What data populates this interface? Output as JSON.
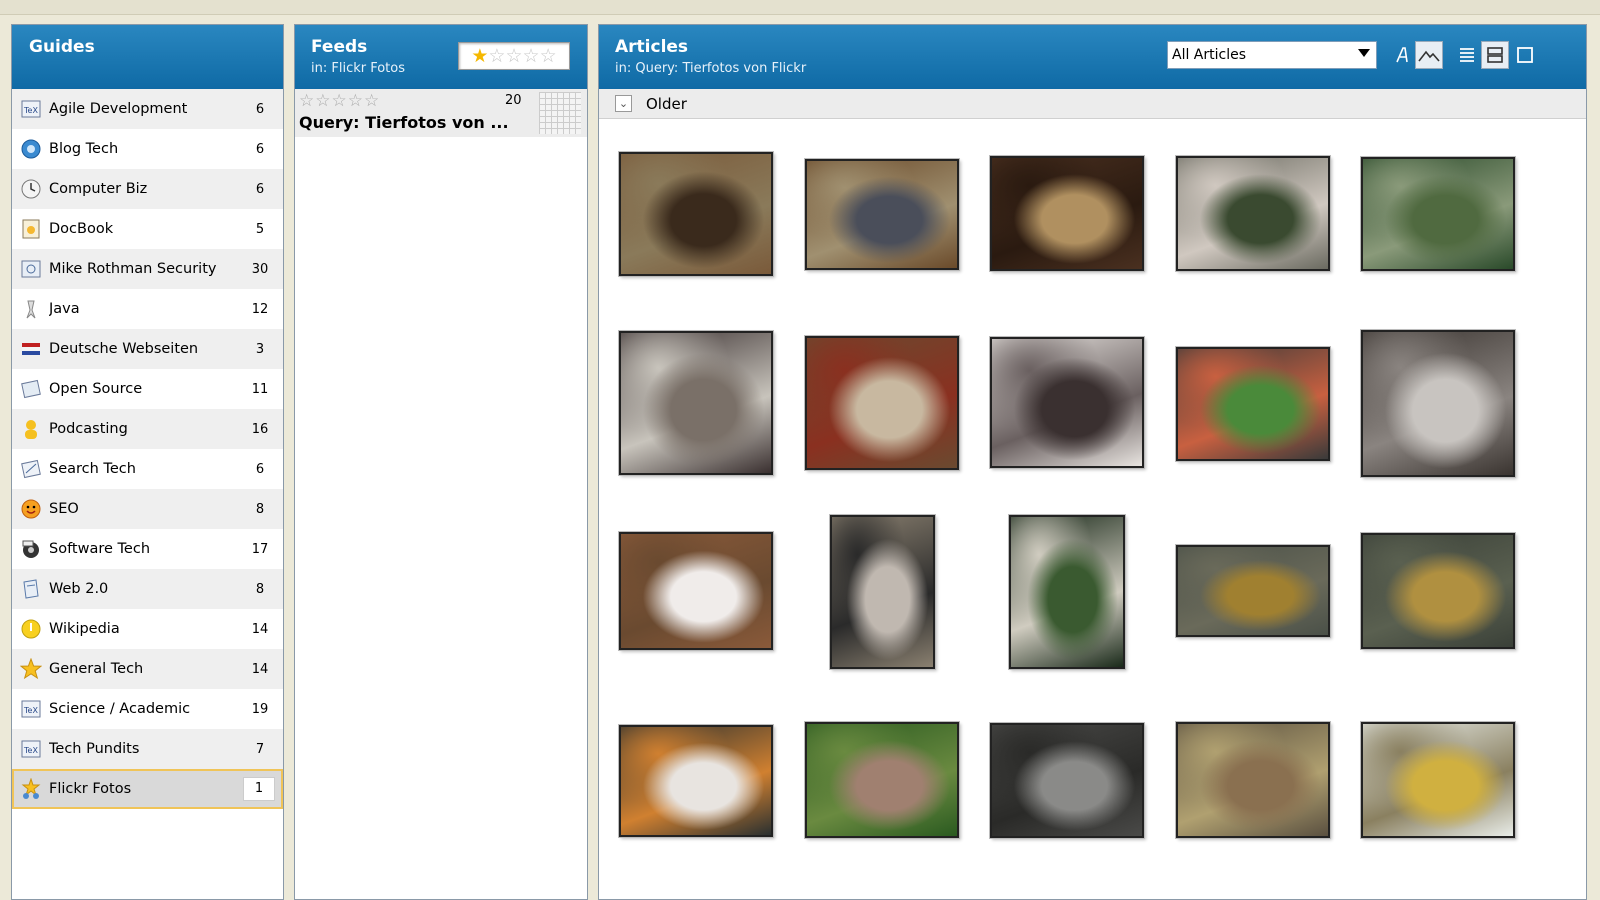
{
  "guides": {
    "title": "Guides",
    "items": [
      {
        "label": "Agile Development",
        "count": "6",
        "icon": "tex-document-icon"
      },
      {
        "label": "Blog Tech",
        "count": "6",
        "icon": "gear-globe-icon"
      },
      {
        "label": "Computer Biz",
        "count": "6",
        "icon": "clock-icon"
      },
      {
        "label": "DocBook",
        "count": "5",
        "icon": "docbook-icon"
      },
      {
        "label": "Mike Rothman Security",
        "count": "30",
        "icon": "security-document-icon"
      },
      {
        "label": "Java",
        "count": "12",
        "icon": "java-duke-icon"
      },
      {
        "label": "Deutsche Webseiten",
        "count": "3",
        "icon": "flag-icon"
      },
      {
        "label": "Open Source",
        "count": "11",
        "icon": "open-source-icon"
      },
      {
        "label": "Podcasting",
        "count": "16",
        "icon": "person-icon"
      },
      {
        "label": "Search Tech",
        "count": "6",
        "icon": "search-document-icon"
      },
      {
        "label": "SEO",
        "count": "8",
        "icon": "smiley-icon"
      },
      {
        "label": "Software Tech",
        "count": "17",
        "icon": "cd-icon"
      },
      {
        "label": "Web 2.0",
        "count": "8",
        "icon": "web-icon"
      },
      {
        "label": "Wikipedia",
        "count": "14",
        "icon": "lightbulb-icon"
      },
      {
        "label": "General Tech",
        "count": "14",
        "icon": "star-icon"
      },
      {
        "label": "Science / Academic",
        "count": "19",
        "icon": "tex-document-icon"
      },
      {
        "label": "Tech Pundits",
        "count": "7",
        "icon": "tex-document-icon"
      },
      {
        "label": "Flickr Fotos",
        "count": "1",
        "icon": "star-people-icon",
        "selected": true
      }
    ]
  },
  "feeds": {
    "title": "Feeds",
    "subtitle": "in: Flickr Fotos",
    "rating": 1,
    "rating_max": 5,
    "rows": [
      {
        "title": "Query: Tierfotos von ...",
        "count": "20",
        "rating": 0
      }
    ]
  },
  "articles": {
    "title": "Articles",
    "subtitle": "in: Query: Tierfotos von Flickr",
    "filter_value": "All Articles",
    "toolbar": [
      "font-icon",
      "image-view-icon",
      "list-view-icon",
      "detail-view-icon",
      "single-view-icon"
    ],
    "group_label": "Older",
    "thumbnails": [
      {
        "subject": "brown horse with saddle",
        "colors": [
          "#7a5a3a",
          "#3a2a1c",
          "#8a7a5a"
        ]
      },
      {
        "subject": "horse on road",
        "colors": [
          "#6a4a2a",
          "#4a4e5a",
          "#a09070"
        ]
      },
      {
        "subject": "horse head closeup",
        "colors": [
          "#4a3020",
          "#b09060",
          "#2a1a10"
        ]
      },
      {
        "subject": "woman with dog",
        "colors": [
          "#6a6a60",
          "#3a4a30",
          "#d0c8c0"
        ]
      },
      {
        "subject": "garden sign",
        "colors": [
          "#2a4a2a",
          "#506a40",
          "#8a9a7a"
        ]
      },
      {
        "subject": "two ponies",
        "colors": [
          "#3a3030",
          "#7a7068",
          "#c8c4bc"
        ]
      },
      {
        "subject": "roosters",
        "colors": [
          "#6a4a30",
          "#c8b8a0",
          "#8a3020"
        ]
      },
      {
        "subject": "pony closeup",
        "colors": [
          "#e8e4e0",
          "#3a3030",
          "#6a6060"
        ]
      },
      {
        "subject": "lovebird parrot",
        "colors": [
          "#3a3a3a",
          "#4a8a3a",
          "#c86040"
        ]
      },
      {
        "subject": "sleeping cats",
        "colors": [
          "#3a3430",
          "#c8c4c0",
          "#8a8480"
        ]
      },
      {
        "subject": "white rabbit",
        "colors": [
          "#8a5a3a",
          "#f0ecea",
          "#6a4a30"
        ]
      },
      {
        "subject": "woodpecker on tree",
        "colors": [
          "#8a8070",
          "#c0b8b0",
          "#2a2a2a"
        ]
      },
      {
        "subject": "dog behind fence",
        "colors": [
          "#1a2a1a",
          "#3a5a30",
          "#d0ccc0"
        ]
      },
      {
        "subject": "ducklings",
        "colors": [
          "#4a5048",
          "#a08030",
          "#6a6a5a"
        ]
      },
      {
        "subject": "ducklings on water",
        "colors": [
          "#3a4038",
          "#b09040",
          "#5a6050"
        ]
      },
      {
        "subject": "white duck",
        "colors": [
          "#2a3030",
          "#e8e4e0",
          "#d08030"
        ]
      },
      {
        "subject": "dove on branch",
        "colors": [
          "#2a5a20",
          "#a08070",
          "#6a8a40"
        ]
      },
      {
        "subject": "bird in water",
        "colors": [
          "#4a4a48",
          "#8a8a88",
          "#2a2a28"
        ]
      },
      {
        "subject": "mallard duck",
        "colors": [
          "#5a5040",
          "#8a7050",
          "#b0a070"
        ]
      },
      {
        "subject": "duck bill closeup",
        "colors": [
          "#e8ece8",
          "#d0b040",
          "#8a8060"
        ]
      }
    ]
  }
}
